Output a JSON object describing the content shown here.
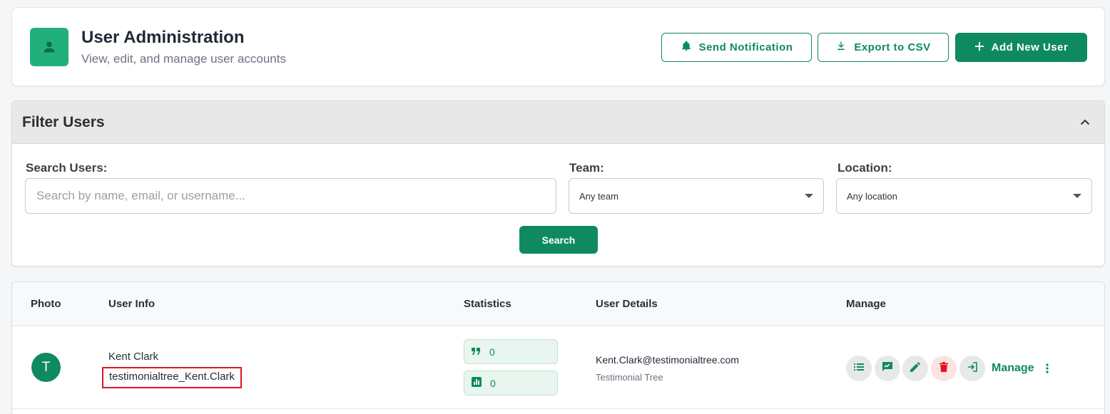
{
  "header": {
    "title": "User Administration",
    "subtitle": "View, edit, and manage user accounts",
    "buttons": {
      "notify": "Send Notification",
      "export": "Export to CSV",
      "add": "Add New User"
    }
  },
  "filter": {
    "title": "Filter Users",
    "search_label": "Search Users:",
    "search_placeholder": "Search by name, email, or username...",
    "team_label": "Team:",
    "team_value": "Any team",
    "location_label": "Location:",
    "location_value": "Any location",
    "search_button": "Search"
  },
  "table": {
    "columns": [
      "Photo",
      "User Info",
      "Statistics",
      "User Details",
      "Manage"
    ],
    "rows": [
      {
        "avatar_initial": "T",
        "name": "Kent Clark",
        "username": "testimonialtree_Kent.Clark",
        "stat_testimonials": "0",
        "stat_reports": "0",
        "email": "Kent.Clark@testimonialtree.com",
        "company": "Testimonial Tree",
        "manage_label": "Manage"
      }
    ]
  },
  "colors": {
    "accent": "#0f8a5f",
    "accent_light": "#22b07a",
    "danger": "#e0161e"
  },
  "icons": [
    "user-icon",
    "bell-icon",
    "download-icon",
    "plus-icon",
    "chevron-up-icon",
    "caret-down-icon",
    "quote-icon",
    "chart-icon",
    "list-icon",
    "message-icon",
    "pencil-icon",
    "trash-icon",
    "login-icon",
    "more-vertical-icon"
  ]
}
